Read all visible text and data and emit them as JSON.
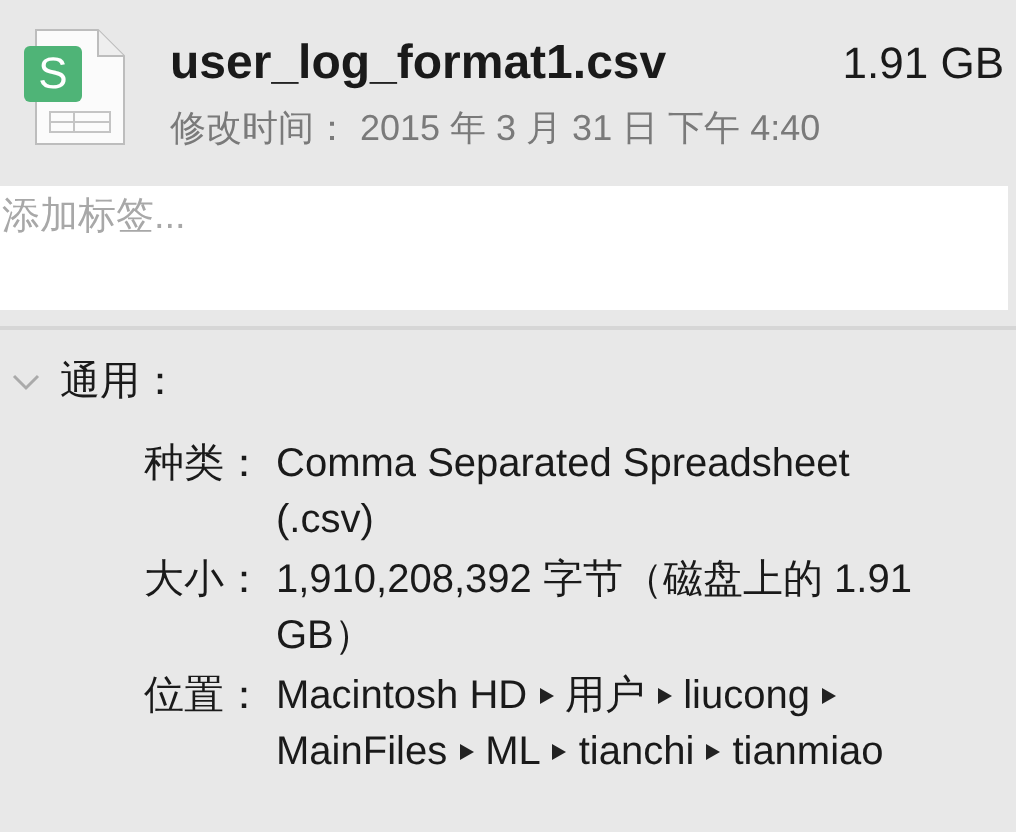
{
  "file": {
    "badge_letter": "S",
    "name": "user_log_format1.csv",
    "size": "1.91 GB",
    "modified": "修改时间： 2015 年 3 月 31 日 下午 4:40"
  },
  "tags": {
    "placeholder": "添加标签..."
  },
  "section": {
    "title": "通用：",
    "expanded": true,
    "rows": [
      {
        "label": "种类：",
        "kind": "text",
        "value": "Comma Separated Spreadsheet (.csv)"
      },
      {
        "label": "大小：",
        "kind": "text",
        "value": "1,910,208,392 字节（磁盘上的 1.91 GB）"
      },
      {
        "label": "位置：",
        "kind": "path",
        "segments": [
          "Macintosh HD",
          "用户",
          "liucong",
          "MainFiles",
          "ML",
          "tianchi",
          "tianmiao"
        ]
      }
    ]
  }
}
